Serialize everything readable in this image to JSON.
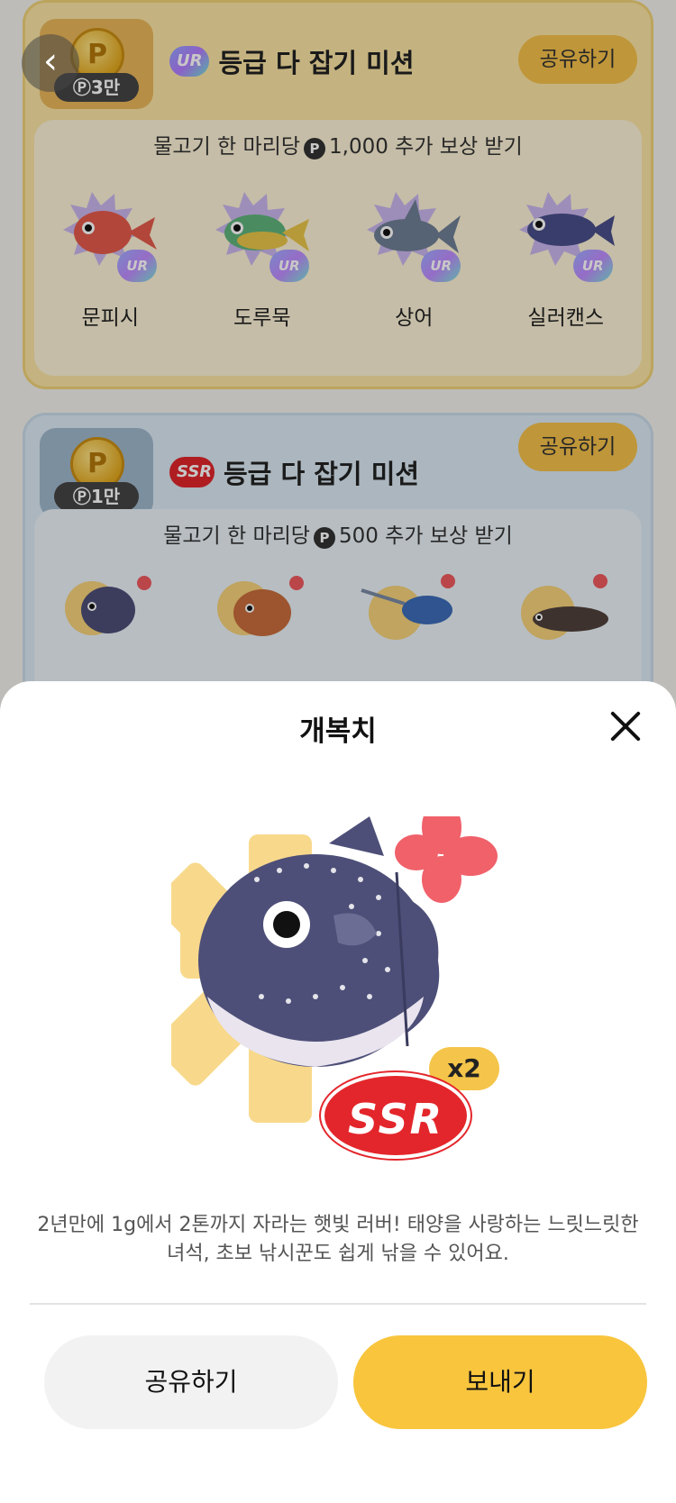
{
  "background": {
    "ur_mission": {
      "reward_label": "3만",
      "grade_badge": "UR",
      "title": "등급 다 잡기 미션",
      "share_label": "공유하기",
      "reward_text_before": "물고기 한 마리당",
      "reward_text_after": "1,000 추가 보상 받기",
      "fish": [
        {
          "name": "문피시",
          "grade": "UR",
          "color": "#e45a4b"
        },
        {
          "name": "도루묵",
          "grade": "UR",
          "color": "#5fb47c"
        },
        {
          "name": "상어",
          "grade": "UR",
          "color": "#6f7f95"
        },
        {
          "name": "실러캔스",
          "grade": "UR",
          "color": "#4a4f8a"
        }
      ]
    },
    "ssr_mission": {
      "reward_label": "1만",
      "grade_badge": "SSR",
      "title": "등급 다 잡기 미션",
      "share_label": "공유하기",
      "reward_text_before": "물고기 한 마리당",
      "reward_text_after": "500 추가 보상 받기",
      "fish": [
        {
          "color": "#4d4f78"
        },
        {
          "color": "#c86d3b"
        },
        {
          "color": "#3d6cb8"
        },
        {
          "color": "#50413c"
        }
      ]
    }
  },
  "sheet": {
    "title": "개복치",
    "count": "x2",
    "grade": "SSR",
    "description": "2년만에 1g에서 2톤까지 자라는 햇빛 러버! 태양을 사랑하는 느릿느릿한 녀석, 초보 낚시꾼도 쉽게 낚을 수 있어요.",
    "share_button": "공유하기",
    "send_button": "보내기"
  },
  "colors": {
    "accent": "#f8c53d",
    "ssr_red": "#e3262b",
    "fish_body": "#4d4f78"
  }
}
